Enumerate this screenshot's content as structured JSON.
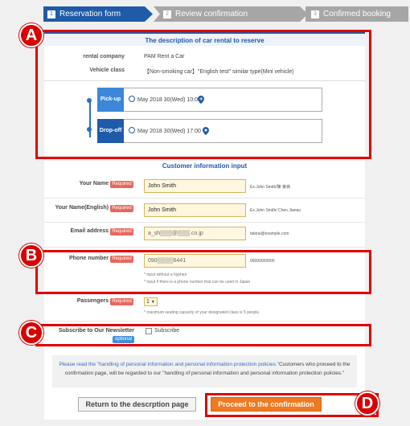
{
  "steps": [
    {
      "num": "1",
      "label": "Reservation form"
    },
    {
      "num": "2",
      "label": "Review confirmation"
    },
    {
      "num": "3",
      "label": "Confirmed booking"
    }
  ],
  "rental": {
    "title": "The description of car rental to reserve",
    "company_label": "rental company",
    "company_value": "PAM Rent a Car",
    "class_label": "Vehicle class",
    "class_value": "【Non-smoking car】\"English test\" similar type(Mini vehicle)",
    "pickup_label": "Pick-up",
    "pickup_value": "May 2018 30(Wed) 10:00",
    "dropoff_label": "Drop-off",
    "dropoff_value": "May 2018 30(Wed) 17:00"
  },
  "customer": {
    "title": "Customer information input",
    "required": "Required",
    "optional": "optional",
    "name_label": "Your Name",
    "name_value": "John Smith",
    "name_example": "Ex.John Smith/陳 東嶺",
    "name_en_label": "Your Name(English)",
    "name_en_value": "John Smith",
    "name_en_example": "Ex.John Smith/ Chen Jianao",
    "email_label": "Email address",
    "email_value": "a_sh▒▒▒@▒▒▒.co.jp",
    "email_example": "tabirai@example.com",
    "phone_label": "Phone number",
    "phone_value": "090▒▒▒▒6441",
    "phone_example": "09000000000",
    "phone_note1": "* input without a hyphen",
    "phone_note2": "* input if there is a phone number that can be used in Japan",
    "passengers_label": "Passengers",
    "passengers_value": "1",
    "passengers_note": "* maximum seating capacity of your designated class is 5 people.",
    "newsletter_label": "Subscribe to Our Newsletter",
    "newsletter_check": "Subscribe"
  },
  "policy": {
    "link": "Please read the \"handling of personal information and personal information protection policies.\"",
    "text": "Customers who proceed to the confirmation page, will be regarded to our \"handling of personal information and personal information protection policies.\""
  },
  "buttons": {
    "back": "Return to the descrption page",
    "proceed": "Proceed to the confirmation"
  },
  "markers": [
    "A",
    "B",
    "C",
    "D"
  ],
  "colors": {
    "brand": "#1f5ba8",
    "accent": "#ee7a22",
    "highlight": "#e10000"
  }
}
